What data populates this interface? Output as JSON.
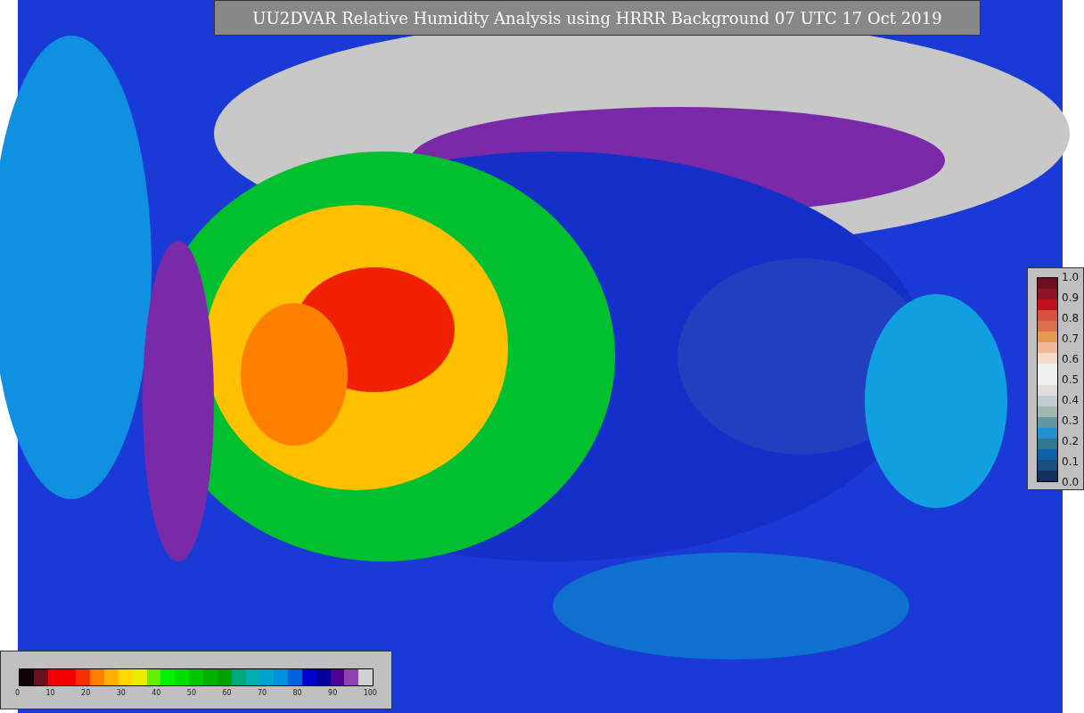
{
  "title": "UU2DVAR Relative Humidity Analysis using HRRR Background 07 UTC 17 Oct 2019",
  "humidity_colorbar": {
    "segments": [
      {
        "color": "#100008"
      },
      {
        "color": "#6a1020"
      },
      {
        "color": "#f00000"
      },
      {
        "color": "#f40000"
      },
      {
        "color": "#f83000"
      },
      {
        "color": "#ff8000"
      },
      {
        "color": "#ffb000"
      },
      {
        "color": "#ffd800"
      },
      {
        "color": "#e8ec00"
      },
      {
        "color": "#60f000"
      },
      {
        "color": "#00f000"
      },
      {
        "color": "#00e000"
      },
      {
        "color": "#00c800"
      },
      {
        "color": "#00b000"
      },
      {
        "color": "#00a000"
      },
      {
        "color": "#00a880"
      },
      {
        "color": "#00b0b0"
      },
      {
        "color": "#00a0d0"
      },
      {
        "color": "#0090e0"
      },
      {
        "color": "#0060e0"
      },
      {
        "color": "#0000d0"
      },
      {
        "color": "#0000a0"
      },
      {
        "color": "#500090"
      },
      {
        "color": "#9040b0"
      },
      {
        "color": "#d0d0d0"
      }
    ],
    "ticks": [
      "0",
      "10",
      "20",
      "30",
      "40",
      "50",
      "60",
      "70",
      "80",
      "90",
      "100"
    ]
  },
  "ratio_colorbar": {
    "segments": [
      {
        "color": "#6b0f1f"
      },
      {
        "color": "#8c1428"
      },
      {
        "color": "#c01020"
      },
      {
        "color": "#d85040"
      },
      {
        "color": "#d87050"
      },
      {
        "color": "#e49a50"
      },
      {
        "color": "#f0b898"
      },
      {
        "color": "#f8d8c8"
      },
      {
        "color": "#f0f0f0"
      },
      {
        "color": "#f0f0f0"
      },
      {
        "color": "#e0dcdc"
      },
      {
        "color": "#c0ccd4"
      },
      {
        "color": "#a0b8b0"
      },
      {
        "color": "#6098a0"
      },
      {
        "color": "#2090d0"
      },
      {
        "color": "#307890"
      },
      {
        "color": "#1060a8"
      },
      {
        "color": "#185080"
      },
      {
        "color": "#103060"
      }
    ],
    "ticks": [
      "1.0",
      "0.9",
      "0.8",
      "0.7",
      "0.6",
      "0.5",
      "0.4",
      "0.3",
      "0.2",
      "0.1",
      "0.0"
    ]
  }
}
